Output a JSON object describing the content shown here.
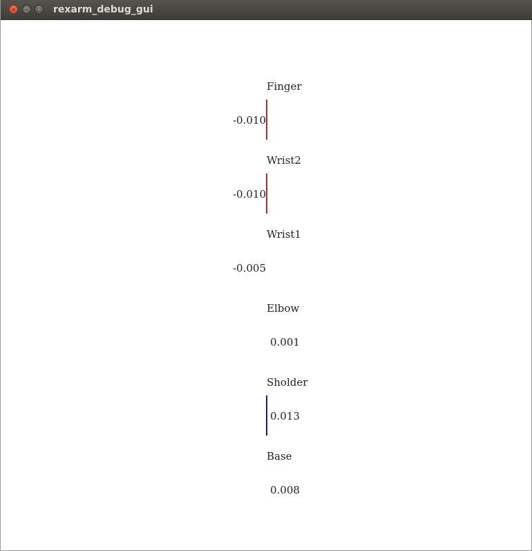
{
  "window": {
    "title": "rexarm_debug_gui",
    "buttons": {
      "close": "×",
      "minimize": "–",
      "maximize": "□"
    }
  },
  "joints": [
    {
      "name": "Finger",
      "value": "-0.010",
      "bar": true,
      "bar_color": "#c0262d"
    },
    {
      "name": "Wrist2",
      "value": "-0.010",
      "bar": true,
      "bar_color": "#c0262d"
    },
    {
      "name": "Wrist1",
      "value": "-0.005",
      "bar": false,
      "bar_color": "#c0262d"
    },
    {
      "name": "Elbow",
      "value": "0.001",
      "bar": false,
      "bar_color": "#1a1a8c"
    },
    {
      "name": "Sholder",
      "value": "0.013",
      "bar": true,
      "bar_color": "#1a1a8c"
    },
    {
      "name": "Base",
      "value": "0.008",
      "bar": false,
      "bar_color": "#1a1a8c"
    }
  ]
}
